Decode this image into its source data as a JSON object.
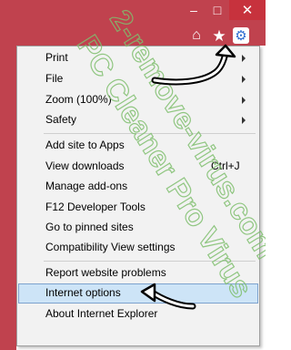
{
  "window": {
    "minimize_glyph": "–",
    "maximize_glyph": "□",
    "close_glyph": "✕"
  },
  "toolbar": {
    "icons": [
      "home-icon",
      "star-icon",
      "gear-icon"
    ]
  },
  "menu": {
    "items": [
      {
        "label": "Print",
        "submenu": true
      },
      {
        "label": "File",
        "submenu": true
      },
      {
        "label": "Zoom (100%)",
        "submenu": true
      },
      {
        "label": "Safety",
        "submenu": true
      },
      {
        "label": "Add site to Apps"
      },
      {
        "label": "View downloads",
        "shortcut": "Ctrl+J"
      },
      {
        "label": "Manage add-ons"
      },
      {
        "label": "F12 Developer Tools"
      },
      {
        "label": "Go to pinned sites"
      },
      {
        "label": "Compatibility View settings"
      },
      {
        "label": "Report website problems"
      },
      {
        "label": "Internet options",
        "highlighted": true
      },
      {
        "label": "About Internet Explorer"
      }
    ]
  },
  "watermark": {
    "line1": "2-remove-virus.com",
    "line2": "PC Cleaner Pro Virus"
  },
  "colors": {
    "titlebar": "#c0424e",
    "menu_bg": "#f2f2f2",
    "highlight": "#cde4f7",
    "watermark": "#7fbf6e"
  }
}
